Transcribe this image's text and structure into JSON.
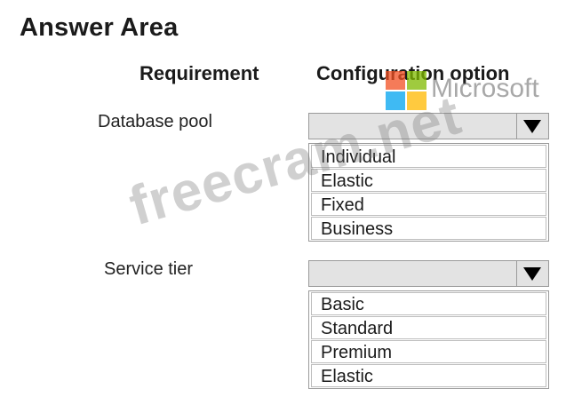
{
  "title": "Answer Area",
  "columns": {
    "requirement": "Requirement",
    "option": "Configuration option"
  },
  "rows": [
    {
      "label": "Database pool",
      "options": [
        "Individual",
        "Elastic",
        "Fixed",
        "Business"
      ]
    },
    {
      "label": "Service tier",
      "options": [
        "Basic",
        "Standard",
        "Premium",
        "Elastic"
      ]
    }
  ],
  "watermarks": {
    "site": "freecram.net",
    "brand": "Microsoft",
    "brand_colors": [
      "#f25022",
      "#7fba00",
      "#00a4ef",
      "#ffb900"
    ]
  },
  "icons": {
    "dropdown": "triangle-down-icon"
  }
}
